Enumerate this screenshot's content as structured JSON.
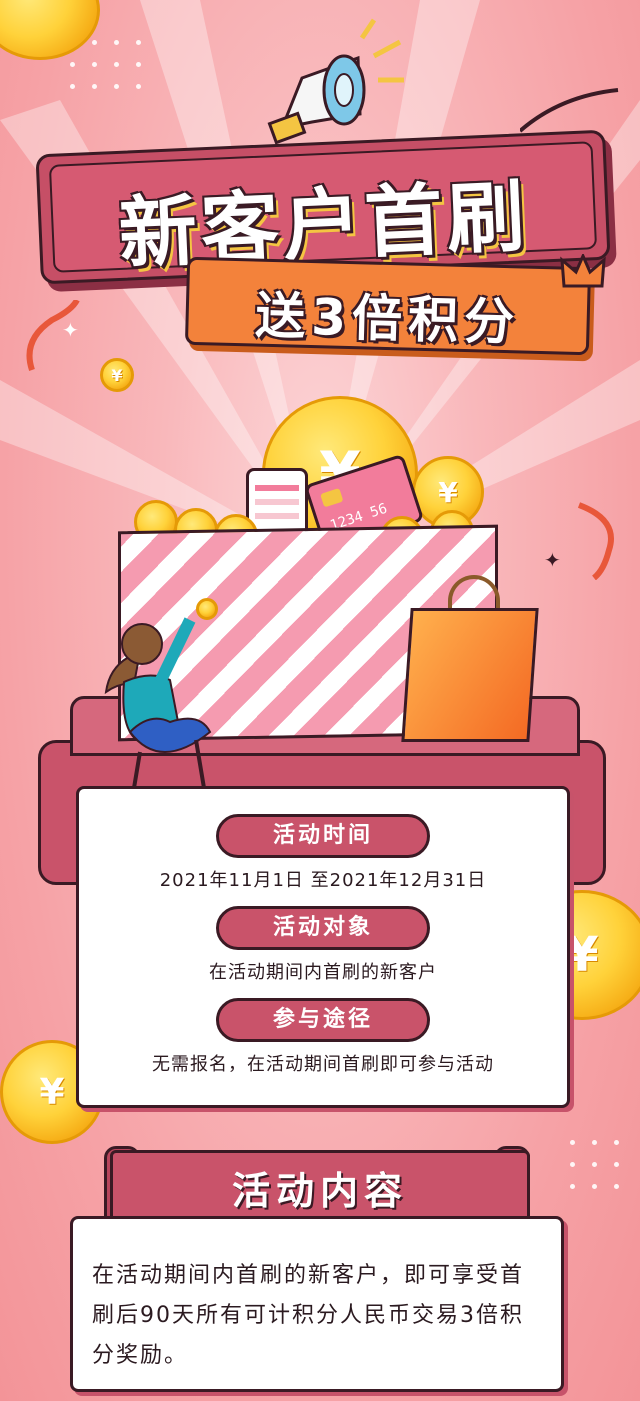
{
  "banner": {
    "title": "新客户首刷",
    "subtitle": "送3倍积分"
  },
  "coin_symbol": "¥",
  "info": {
    "time_label": "活动时间",
    "time_value": "2021年11月1日 至2021年12月31日",
    "target_label": "活动对象",
    "target_value": "在活动期间内首刷的新客户",
    "method_label": "参与途径",
    "method_value": "无需报名，在活动期间首刷即可参与活动"
  },
  "content": {
    "title": "活动内容",
    "body": "在活动期间内首刷的新客户，即可享受首刷后90天所有可计积分人民币交易3倍积分奖励。"
  },
  "card_number": "1234 56",
  "colors": {
    "background": "#f8a9ad",
    "banner_red": "#c9536a",
    "banner_orange": "#f3823b",
    "coin_gold": "#ffd23a",
    "outline": "#3a1a24"
  }
}
